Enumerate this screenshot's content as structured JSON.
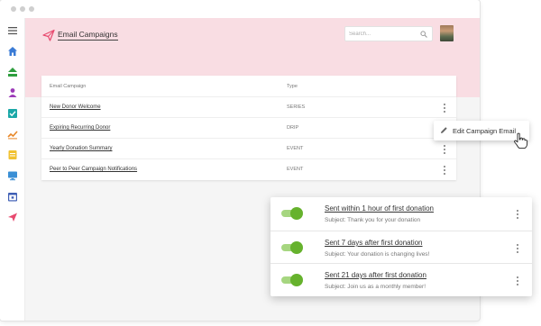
{
  "page": {
    "title": "Email Campaigns"
  },
  "search": {
    "placeholder": "Search..."
  },
  "table": {
    "headers": [
      "Email Campaign",
      "Type"
    ],
    "rows": [
      {
        "name": "New Donor Welcome",
        "type": "SERIES"
      },
      {
        "name": "Expiring Recurring Donor",
        "type": "DRIP"
      },
      {
        "name": "Yearly Donation Summary",
        "type": "EVENT"
      },
      {
        "name": "Peer to Peer Campaign Notifications",
        "type": "EVENT"
      }
    ]
  },
  "context_menu": {
    "label": "Edit Campaign Email",
    "icon": "pencil-icon"
  },
  "schedule_panel": {
    "items": [
      {
        "title": "Sent within 1 hour of first donation",
        "subject": "Subject: Thank you for your donation",
        "enabled": true
      },
      {
        "title": "Sent 7 days after first donation",
        "subject": "Subject: Your donation is changing lives!",
        "enabled": true
      },
      {
        "title": "Sent 21 days after first donation",
        "subject": "Subject: Join us as a monthly member!",
        "enabled": true
      }
    ]
  },
  "sidebar": {
    "icons": [
      "menu-icon",
      "home-icon",
      "upload-icon",
      "people-icon",
      "checkbox-icon",
      "trending-icon",
      "note-icon",
      "monitor-icon",
      "calendar-icon",
      "send-icon"
    ]
  },
  "colors": {
    "header_band": "#f9dde3",
    "accent_pink": "#e84a6f",
    "toggle_on": "#66b22d"
  }
}
